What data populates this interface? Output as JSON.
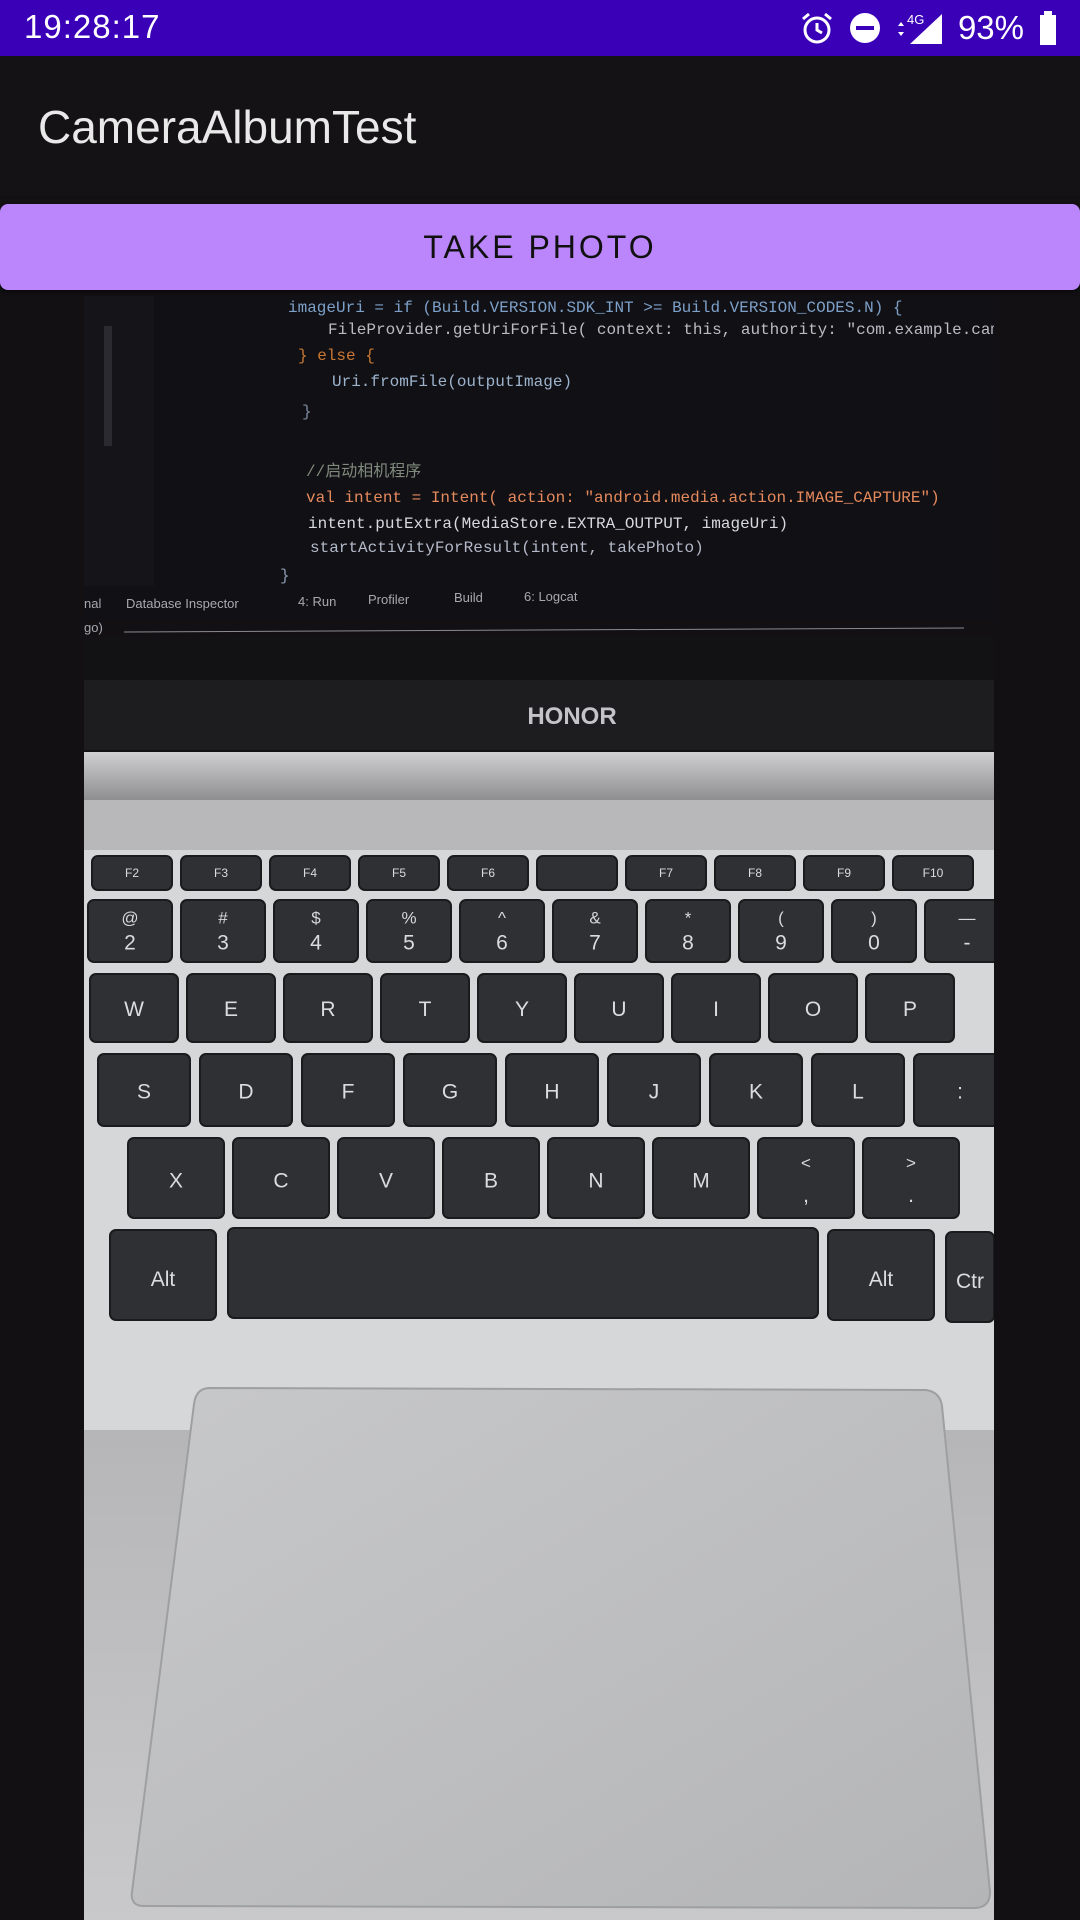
{
  "status_bar": {
    "time": "19:28:17",
    "network": "4G",
    "battery_percent": "93%",
    "icons": [
      "alarm-icon",
      "do-not-disturb-icon",
      "signal-icon",
      "battery-icon"
    ]
  },
  "app_bar": {
    "title": "CameraAlbumTest"
  },
  "take_photo_button": {
    "label": "TAKE PHOTO"
  },
  "photo": {
    "ide_code_lines": [
      "imageUri = if (Build.VERSION.SDK_INT >= Build.VERSION_CODES.N) {",
      "FileProvider.getUriForFile( context: this,  authority: \"com.example.cameraa",
      "} else {",
      "Uri.fromFile(outputImage)",
      "}",
      "//启动相机程序",
      "val intent = Intent( action: \"android.media.action.IMAGE_CAPTURE\")",
      "intent.putExtra(MediaStore.EXTRA_OUTPUT, imageUri)",
      "startActivityForResult(intent, takePhoto)",
      "}"
    ],
    "ide_tool_tabs": [
      "nal",
      "Database Inspector",
      "4: Run",
      "Profiler",
      "Build",
      "6: Logcat"
    ],
    "ide_status_text": "go)",
    "brand": "HONOR",
    "keyboard_rows": {
      "function": [
        "F2",
        "F3",
        "F4",
        "F5",
        "F6",
        "",
        "F7",
        "F8",
        "F9",
        "F10"
      ],
      "number_top": [
        "@",
        "#",
        "$",
        "%",
        "^",
        "&",
        "*",
        "(",
        ")",
        "—"
      ],
      "number_bottom": [
        "2",
        "3",
        "4",
        "5",
        "6",
        "7",
        "8",
        "9",
        "0",
        "-"
      ],
      "qwerty": [
        "W",
        "E",
        "R",
        "T",
        "Y",
        "U",
        "I",
        "O",
        "P"
      ],
      "home": [
        "S",
        "D",
        "F",
        "G",
        "H",
        "J",
        "K",
        "L",
        ":"
      ],
      "bottom": [
        "X",
        "C",
        "V",
        "B",
        "N",
        "M",
        "<",
        ">"
      ],
      "bottom_sub": [
        "",
        "",
        "",
        "",
        "",
        "",
        ",",
        "."
      ],
      "space_row": [
        "Alt",
        "Alt",
        "Ctr"
      ]
    }
  },
  "colors": {
    "status_bar_bg": "#3a00b8",
    "app_bg": "#141214",
    "button_bg": "#bb86fc"
  }
}
